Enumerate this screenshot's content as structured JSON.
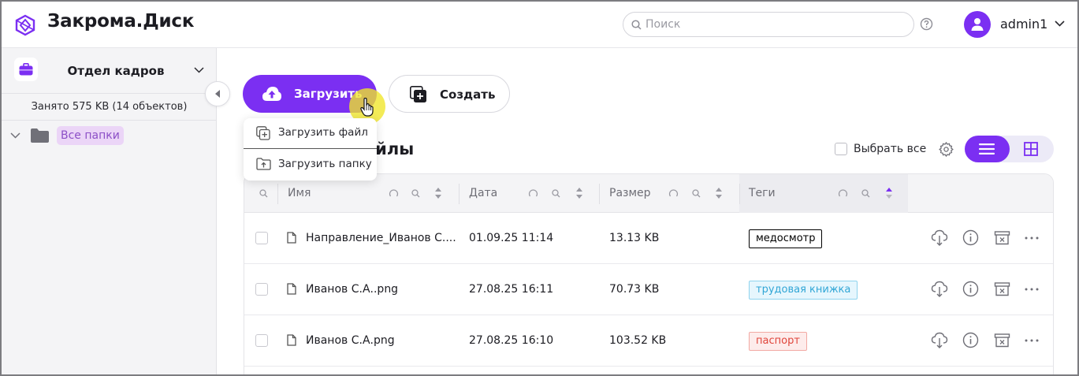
{
  "app": {
    "title": "Закрома.Диск"
  },
  "search": {
    "placeholder": "Поиск"
  },
  "user": {
    "name": "admin1"
  },
  "sidebar": {
    "department": "Отдел кадров",
    "usage": "Занято 575 KB (14 объектов)",
    "tree": [
      {
        "label": "Все папки"
      }
    ]
  },
  "toolbar": {
    "upload_label": "Загрузить",
    "create_label": "Создать"
  },
  "dropdown": {
    "items": [
      {
        "label": "Загрузить файл"
      },
      {
        "label": "Загрузить папку"
      }
    ]
  },
  "section": {
    "title": "айлы",
    "select_all": "Выбрать все"
  },
  "table": {
    "columns": [
      {
        "label": "Имя"
      },
      {
        "label": "Дата"
      },
      {
        "label": "Размер"
      },
      {
        "label": "Теги"
      }
    ],
    "rows": [
      {
        "name": "Направление_Иванов С....",
        "date": "01.09.25 11:14",
        "size": "13.13 KB",
        "tag": "медосмотр"
      },
      {
        "name": "Иванов С.А..png",
        "date": "27.08.25 16:11",
        "size": "70.73 KB",
        "tag": "трудовая книжка"
      },
      {
        "name": "Иванов С.А.png",
        "date": "27.08.25 16:10",
        "size": "103.52 KB",
        "tag": "паспорт"
      }
    ]
  },
  "colors": {
    "accent": "#7b2ff2",
    "tag_medosmotr": "#000000",
    "tag_trudovaya": "#31a6d6",
    "tag_pasport": "#e0453b"
  },
  "icons": [
    "logo-icon",
    "search-icon",
    "help-icon",
    "user-icon",
    "chevron-down-icon",
    "briefcase-icon",
    "folder-icon",
    "chevron-left-icon",
    "cloud-upload-icon",
    "add-square-icon",
    "file-plus-icon",
    "folder-upload-icon",
    "gear-icon",
    "list-view-icon",
    "grid-view-icon",
    "file-icon",
    "cloud-download-icon",
    "info-icon",
    "archive-icon",
    "more-icon"
  ]
}
